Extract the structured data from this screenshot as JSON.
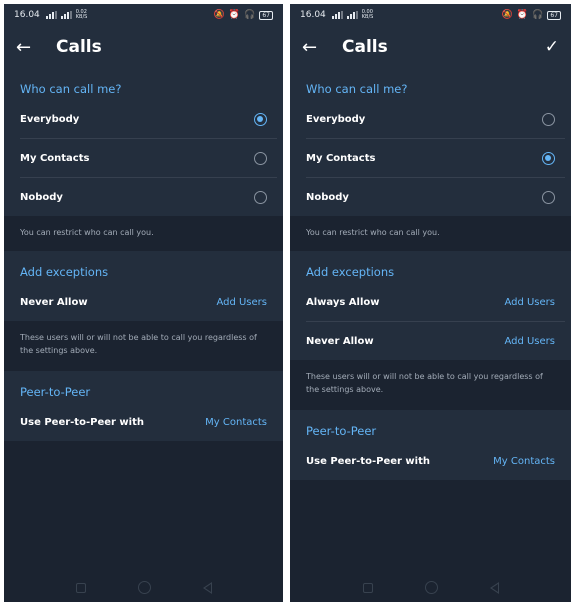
{
  "left": {
    "status": {
      "time": "16.04",
      "speed": "0.02 KB/S",
      "battery": "67"
    },
    "title": "Calls",
    "section1": {
      "header": "Who can call me?",
      "options": [
        {
          "label": "Everybody",
          "selected": true
        },
        {
          "label": "My Contacts",
          "selected": false
        },
        {
          "label": "Nobody",
          "selected": false
        }
      ],
      "hint": "You can restrict who can call you."
    },
    "section2": {
      "header": "Add exceptions",
      "rows": [
        {
          "label": "Never Allow",
          "action": "Add Users"
        }
      ],
      "hint": "These users will or will not be able to call you regardless of the settings above."
    },
    "section3": {
      "header": "Peer-to-Peer",
      "rows": [
        {
          "label": "Use Peer-to-Peer with",
          "action": "My Contacts"
        }
      ]
    }
  },
  "right": {
    "status": {
      "time": "16.04",
      "speed": "0.00 KB/S",
      "battery": "67"
    },
    "title": "Calls",
    "section1": {
      "header": "Who can call me?",
      "options": [
        {
          "label": "Everybody",
          "selected": false
        },
        {
          "label": "My Contacts",
          "selected": true
        },
        {
          "label": "Nobody",
          "selected": false
        }
      ],
      "hint": "You can restrict who can call you."
    },
    "section2": {
      "header": "Add exceptions",
      "rows": [
        {
          "label": "Always Allow",
          "action": "Add Users"
        },
        {
          "label": "Never Allow",
          "action": "Add Users"
        }
      ],
      "hint": "These users will or will not be able to call you regardless of the settings above."
    },
    "section3": {
      "header": "Peer-to-Peer",
      "rows": [
        {
          "label": "Use Peer-to-Peer with",
          "action": "My Contacts"
        }
      ]
    }
  },
  "icons": {
    "back": "arrow-left",
    "confirm": "checkmark",
    "radio_on": "radio-selected",
    "radio_off": "radio-unselected"
  },
  "colors": {
    "accent": "#64b5f6",
    "background": "#1b2330",
    "surface": "#232e3d"
  }
}
